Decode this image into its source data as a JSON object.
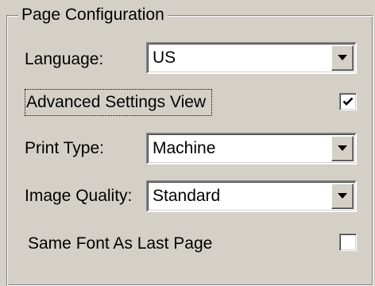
{
  "group": {
    "title": "Page Configuration"
  },
  "language": {
    "label": "Language:",
    "value": "US"
  },
  "advanced_view": {
    "label": "Advanced Settings View",
    "checked": true
  },
  "print_type": {
    "label": "Print Type:",
    "value": "Machine"
  },
  "image_quality": {
    "label": "Image Quality:",
    "value": "Standard"
  },
  "same_font": {
    "label": "Same Font As Last Page",
    "checked": false
  },
  "icons": {
    "dropdown": "chevron-down-icon",
    "check": "checkmark-icon"
  },
  "colors": {
    "face": "#d4d0c8",
    "field": "#ffffff",
    "shadow": "#808080"
  }
}
